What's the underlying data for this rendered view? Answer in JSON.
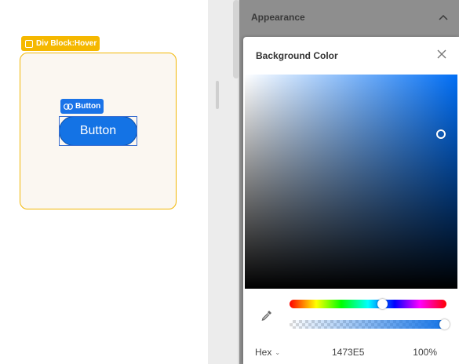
{
  "canvas": {
    "hover_tag_label": "Div Block:Hover",
    "button_tag_label": "Button",
    "preview_button_label": "Button"
  },
  "panel": {
    "section_title": "Appearance"
  },
  "color_picker": {
    "title": "Background Color",
    "format_label": "Hex",
    "hex_value": "1473E5",
    "alpha_value": "100%",
    "hue_level": 0.6,
    "alpha_level": 1.0,
    "selected_color": "#1473E5"
  },
  "colors": {
    "selection_yellow": "#F5B800",
    "accent_blue": "#1A73E8",
    "button_blue": "#1473E5"
  }
}
